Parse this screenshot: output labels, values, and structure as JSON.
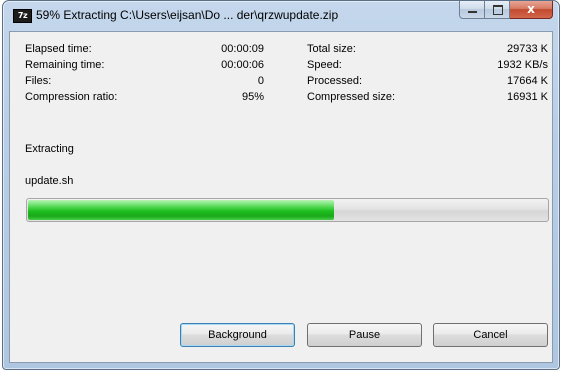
{
  "window": {
    "title": "59% Extracting C:\\Users\\eijsan\\Do ... der\\qrzwupdate.zip",
    "icon": "7z-app-icon",
    "icon_text": "7z",
    "caption": {
      "minimize": "minimize-icon",
      "maximize": "maximize-icon",
      "close": "close-icon",
      "close_glyph": "x"
    }
  },
  "stats": {
    "elapsed_time": {
      "label": "Elapsed time:",
      "value": "00:00:09"
    },
    "remaining_time": {
      "label": "Remaining time:",
      "value": "00:00:06"
    },
    "files": {
      "label": "Files:",
      "value": "0"
    },
    "compression_ratio": {
      "label": "Compression ratio:",
      "value": "95%"
    },
    "total_size": {
      "label": "Total size:",
      "value": "29733 K"
    },
    "speed": {
      "label": "Speed:",
      "value": "1932 KB/s"
    },
    "processed": {
      "label": "Processed:",
      "value": "17664 K"
    },
    "compressed_size": {
      "label": "Compressed size:",
      "value": "16931 K"
    }
  },
  "status": "Extracting",
  "current_file": "update.sh",
  "progress": {
    "fraction": 0.59,
    "fill_color": "#1fbf1f"
  },
  "buttons": {
    "background": "Background",
    "pause": "Pause",
    "cancel": "Cancel"
  }
}
